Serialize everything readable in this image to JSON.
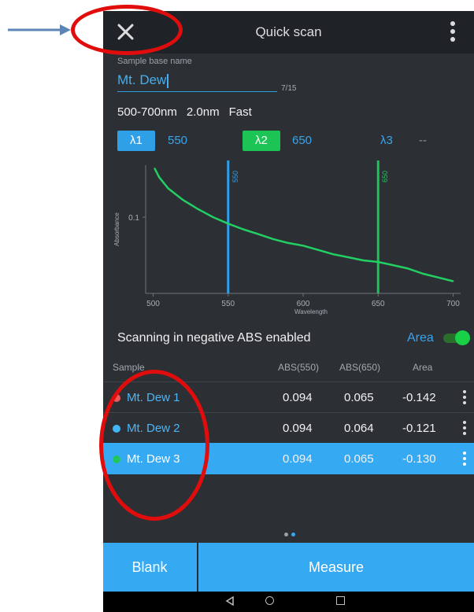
{
  "app": {
    "title": "Quick scan"
  },
  "sample": {
    "label": "Sample base name",
    "value": "Mt. Dew",
    "counter": "7/15"
  },
  "params": {
    "range": "500-700nm",
    "step": "2.0nm",
    "speed": "Fast"
  },
  "lambdas": [
    {
      "label": "λ1",
      "value": "550",
      "color": "#2f9fe8"
    },
    {
      "label": "λ2",
      "value": "650",
      "color": "#1cc456"
    },
    {
      "label": "λ3",
      "value": "--",
      "color": "#2c3035"
    }
  ],
  "negative_abs": {
    "label": "Scanning in negative ABS enabled",
    "area_label": "Area",
    "area_on": true
  },
  "table": {
    "headers": [
      "Sample",
      "ABS(550)",
      "ABS(650)",
      "Area"
    ],
    "rows": [
      {
        "name": "Mt. Dew 1",
        "abs550": "0.094",
        "abs650": "0.065",
        "area": "-0.142",
        "color": "#ea5b5b",
        "selected": false
      },
      {
        "name": "Mt. Dew 2",
        "abs550": "0.094",
        "abs650": "0.064",
        "area": "-0.121",
        "color": "#43b6f5",
        "selected": false
      },
      {
        "name": "Mt. Dew 3",
        "abs550": "0.094",
        "abs650": "0.065",
        "area": "-0.130",
        "color": "#20c55b",
        "selected": true
      }
    ]
  },
  "buttons": {
    "blank": "Blank",
    "measure": "Measure"
  },
  "pager": {
    "count": 2,
    "active": 1
  },
  "colors": {
    "accent": "#36a9f3",
    "green": "#1cc456",
    "annotation_red": "#e10d0d",
    "annotation_arrow": "#5b86b5"
  },
  "chart_data": {
    "type": "line",
    "xlabel": "Wavelength",
    "ylabel": "Absorbance",
    "xlim": [
      495,
      705
    ],
    "ylim": [
      0.048,
      0.165
    ],
    "y_scale": "log",
    "x_ticks": [
      "500",
      "550",
      "600",
      "650",
      "700"
    ],
    "y_ticks": [
      "0.1"
    ],
    "markers": [
      {
        "x": 550,
        "label": "550",
        "color": "#2f9fe8"
      },
      {
        "x": 650,
        "label": "650",
        "color": "#1cc456"
      }
    ],
    "series": [
      {
        "color": "#22cf63",
        "x": [
          501,
          504,
          510,
          520,
          530,
          540,
          550,
          560,
          570,
          580,
          590,
          600,
          610,
          620,
          630,
          640,
          650,
          660,
          670,
          680,
          690,
          700
        ],
        "y": [
          0.16,
          0.147,
          0.132,
          0.118,
          0.108,
          0.1,
          0.094,
          0.089,
          0.085,
          0.081,
          0.078,
          0.076,
          0.073,
          0.07,
          0.068,
          0.066,
          0.065,
          0.063,
          0.061,
          0.058,
          0.056,
          0.054
        ]
      }
    ]
  }
}
